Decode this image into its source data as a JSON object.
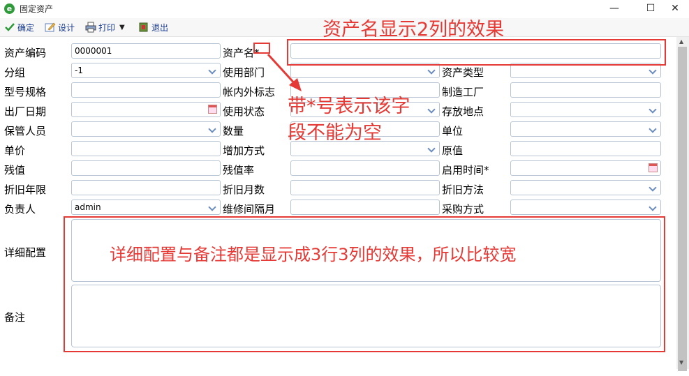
{
  "window": {
    "title": "固定资产",
    "app_icon_letter": "e",
    "minimize": "—",
    "maximize": "☐",
    "close": "✕"
  },
  "toolbar": {
    "confirm": "确定",
    "design": "设计",
    "print": "打印",
    "exit": "退出"
  },
  "form": {
    "labels": {
      "asset_code": "资产编码",
      "asset_name": "资产名*",
      "group": "分组",
      "dept": "使用部门",
      "asset_type": "资产类型",
      "model": "型号规格",
      "inside_flag": "帐内外标志",
      "manufacturer": "制造工厂",
      "factory_date": "出厂日期",
      "use_status": "使用状态",
      "location": "存放地点",
      "custodian": "保管人员",
      "quantity": "数量",
      "unit": "单位",
      "unit_price": "单价",
      "add_method": "增加方式",
      "original_value": "原值",
      "residual": "残值",
      "residual_rate": "残值率",
      "start_date": "启用时间*",
      "dep_years": "折旧年限",
      "dep_months": "折旧月数",
      "dep_method": "折旧方法",
      "owner": "负责人",
      "maintenance": "维修间隔月",
      "purchase": "采购方式",
      "detail": "详细配置",
      "remark": "备注"
    },
    "values": {
      "asset_code": "0000001",
      "group": "-1",
      "owner": "admin"
    }
  },
  "annotations": {
    "name_cols": "资产名显示2列的效果",
    "required_line1": "带*号表示该字",
    "required_line2": "段不能为空",
    "textarea": "详细配置与备注都是显示成3行3列的效果，所以比较宽"
  },
  "colors": {
    "annotation": "#e53935",
    "toolbar_text": "#1a3d8f"
  }
}
